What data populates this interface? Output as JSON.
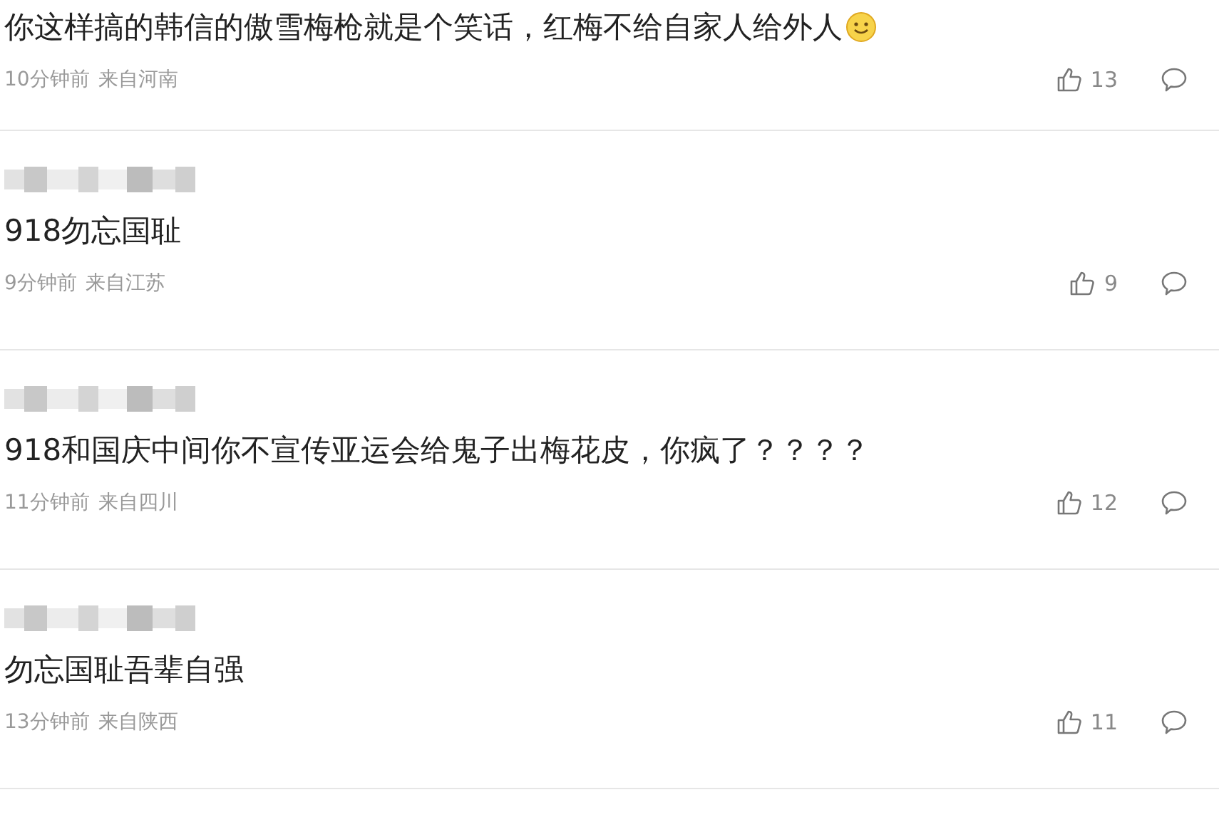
{
  "comments": [
    {
      "show_name": false,
      "text": "你这样搞的韩信的傲雪梅枪就是个笑话，红梅不给自家人给外人",
      "emoji": true,
      "time": "10分钟前",
      "location": "来自河南",
      "likes": "13"
    },
    {
      "show_name": true,
      "text": "918勿忘国耻",
      "emoji": false,
      "time": "9分钟前",
      "location": "来自江苏",
      "likes": "9"
    },
    {
      "show_name": true,
      "text": "918和国庆中间你不宣传亚运会给鬼子出梅花皮，你疯了？？？？",
      "emoji": false,
      "time": "11分钟前",
      "location": "来自四川",
      "likes": "12"
    },
    {
      "show_name": true,
      "text": "勿忘国耻吾辈自强",
      "emoji": false,
      "time": "13分钟前",
      "location": "来自陕西",
      "likes": "11"
    }
  ]
}
